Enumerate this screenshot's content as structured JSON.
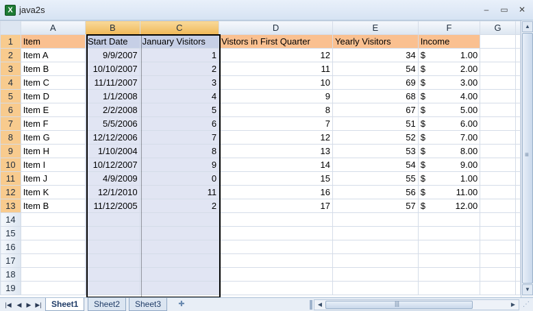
{
  "window": {
    "title": "java2s",
    "app_icon": "excel-icon"
  },
  "columns": [
    "A",
    "B",
    "C",
    "D",
    "E",
    "F",
    "G"
  ],
  "headers": [
    "Item",
    "Start Date",
    "January Visitors",
    "Vistors in First Quarter",
    "Yearly Visitors",
    "Income"
  ],
  "rows": [
    {
      "item": "Item A",
      "start": "9/9/2007",
      "jan": "1",
      "q1": "12",
      "yearly": "34",
      "income": "1.00"
    },
    {
      "item": "Item B",
      "start": "10/10/2007",
      "jan": "2",
      "q1": "11",
      "yearly": "54",
      "income": "2.00"
    },
    {
      "item": "Item C",
      "start": "11/11/2007",
      "jan": "3",
      "q1": "10",
      "yearly": "69",
      "income": "3.00"
    },
    {
      "item": "Item D",
      "start": "1/1/2008",
      "jan": "4",
      "q1": "9",
      "yearly": "68",
      "income": "4.00"
    },
    {
      "item": "Item E",
      "start": "2/2/2008",
      "jan": "5",
      "q1": "8",
      "yearly": "67",
      "income": "5.00"
    },
    {
      "item": "Item F",
      "start": "5/5/2006",
      "jan": "6",
      "q1": "7",
      "yearly": "51",
      "income": "6.00"
    },
    {
      "item": "Item G",
      "start": "12/12/2006",
      "jan": "7",
      "q1": "12",
      "yearly": "52",
      "income": "7.00"
    },
    {
      "item": "Item H",
      "start": "1/10/2004",
      "jan": "8",
      "q1": "13",
      "yearly": "53",
      "income": "8.00"
    },
    {
      "item": "Item I",
      "start": "10/12/2007",
      "jan": "9",
      "q1": "14",
      "yearly": "54",
      "income": "9.00"
    },
    {
      "item": "Item J",
      "start": "4/9/2009",
      "jan": "0",
      "q1": "15",
      "yearly": "55",
      "income": "1.00"
    },
    {
      "item": "Item K",
      "start": "12/1/2010",
      "jan": "11",
      "q1": "16",
      "yearly": "56",
      "income": "11.00"
    },
    {
      "item": "Item B",
      "start": "11/12/2005",
      "jan": "2",
      "q1": "17",
      "yearly": "57",
      "income": "12.00"
    }
  ],
  "row_numbers": [
    "1",
    "2",
    "3",
    "4",
    "5",
    "6",
    "7",
    "8",
    "9",
    "10",
    "11",
    "12",
    "13",
    "14",
    "15",
    "16",
    "17",
    "18",
    "19"
  ],
  "currency_symbol": "$",
  "sheets": [
    "Sheet1",
    "Sheet2",
    "Sheet3"
  ],
  "active_sheet": "Sheet1",
  "selected_columns": [
    "B",
    "C"
  ],
  "colors": {
    "header_fill": "#fac090",
    "selection_fill": "#e1e5f3",
    "selected_col_header": "#f0b857"
  }
}
